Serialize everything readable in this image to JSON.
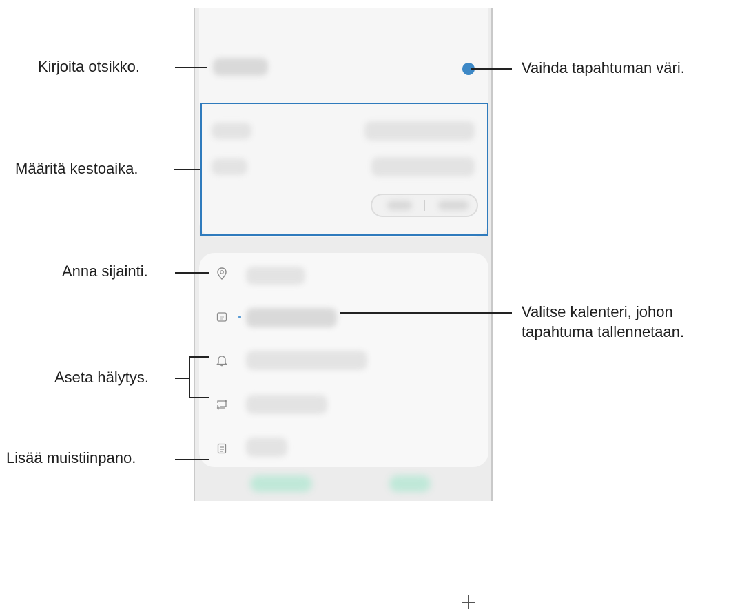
{
  "callouts": {
    "title": "Kirjoita otsikko.",
    "color": "Vaihda tapahtuman väri.",
    "duration": "Määritä kestoaika.",
    "location": "Anna sijainti.",
    "calendar_line1": "Valitse kalenteri, johon",
    "calendar_line2": "tapahtuma tallennetaan.",
    "alarm": "Aseta hälytys.",
    "notes": "Lisää muistiinpano."
  },
  "colors": {
    "event_color": "#3d88c6",
    "highlight_box": "#2f7bbd"
  },
  "icons": [
    "location-pin-icon",
    "calendar-icon",
    "bell-icon",
    "repeat-icon",
    "note-icon",
    "plus-icon"
  ]
}
